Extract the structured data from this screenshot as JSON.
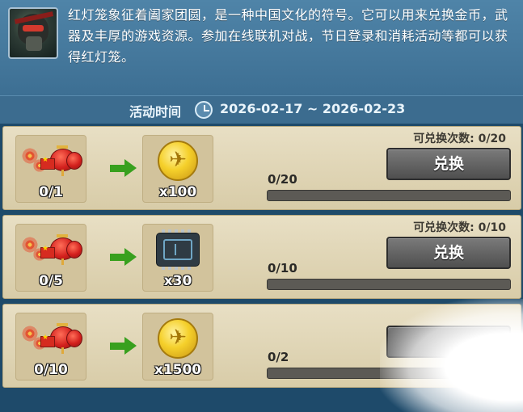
{
  "header": {
    "description": "红灯笼象征着阖家团圆，是一种中国文化的符号。它可以用来兑换金币，武器及丰厚的游戏资源。参加在线联机对战，节日登录和消耗活动等都可以获得红灯笼。",
    "time_label": "活动时间",
    "time_range": "2026-02-17 ~ 2026-02-23",
    "avatar_icon": "soldier-avatar-icon",
    "clock_icon": "clock-icon"
  },
  "rows": [
    {
      "cost_count": "0/1",
      "cost_icon": "red-lantern-icon",
      "reward_icon": "gold-coin-icon",
      "reward_count": "x100",
      "limit_text": "可兑换次数: 0/20",
      "button_label": "兑换",
      "progress_text": "0/20",
      "progress_fraction": 0
    },
    {
      "cost_count": "0/5",
      "cost_icon": "red-lantern-icon",
      "reward_icon": "microchip-icon",
      "reward_count": "x30",
      "limit_text": "可兑换次数: 0/10",
      "button_label": "兑换",
      "progress_text": "0/10",
      "progress_fraction": 0
    },
    {
      "cost_count": "0/10",
      "cost_icon": "red-lantern-icon",
      "reward_icon": "gold-coin-icon",
      "reward_count": "x1500",
      "limit_text": "",
      "button_label": "",
      "progress_text": "0/2",
      "progress_fraction": 0
    }
  ],
  "colors": {
    "arrow": "#38a01e",
    "lantern_red": "#d3201d",
    "coin_gold": "#f5d02b",
    "progress_fill": "#7ec04b"
  }
}
